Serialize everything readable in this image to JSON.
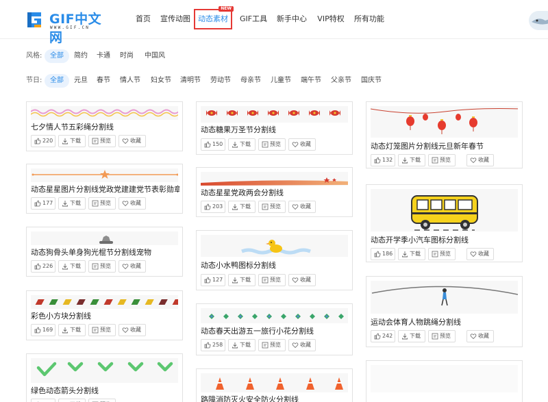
{
  "logo": {
    "text": "GIF中文网",
    "sub": "WWW.GIF.CN"
  },
  "nav": [
    {
      "label": "首页",
      "active": false
    },
    {
      "label": "宣传动图",
      "active": false
    },
    {
      "label": "动态素材",
      "active": true,
      "badge": "NEW"
    },
    {
      "label": "GIF工具",
      "active": false
    },
    {
      "label": "新手中心",
      "active": false
    },
    {
      "label": "VIP特权",
      "active": false
    },
    {
      "label": "所有功能",
      "active": false
    }
  ],
  "filters": {
    "style": {
      "label": "风格:",
      "options": [
        "全部",
        "简约",
        "卡通",
        "时尚",
        "中国风"
      ],
      "selected": 0
    },
    "festival": {
      "label": "节日:",
      "options": [
        "全部",
        "元旦",
        "春节",
        "情人节",
        "妇女节",
        "清明节",
        "劳动节",
        "母亲节",
        "儿童节",
        "端午节",
        "父亲节",
        "国庆节"
      ],
      "selected": 0
    }
  },
  "actions": {
    "download": "下载",
    "preview": "预览",
    "collect": "收藏"
  },
  "cards": [
    {
      "title": "七夕情人节五彩绳分割线",
      "likes": "220",
      "art": "wave"
    },
    {
      "title": "动态星星图片分割线党政党建建党节表彰勋章",
      "likes": "177",
      "art": "starline"
    },
    {
      "title": "动态狗骨头单身狗光棍节分割线宠物",
      "likes": "226",
      "art": "dog"
    },
    {
      "title": "彩色小方块分割线",
      "likes": "169",
      "art": "blocks"
    },
    {
      "title": "绿色动态箭头分割线",
      "likes": "",
      "art": "arrows"
    },
    {
      "title": "动态糖果万圣节分割线",
      "likes": "150",
      "art": "candy"
    },
    {
      "title": "动态星星党政两会分割线",
      "likes": "203",
      "art": "redband"
    },
    {
      "title": "动态小水鸭图标分割线",
      "likes": "127",
      "art": "duck"
    },
    {
      "title": "动态春天出游五一旅行小花分割线",
      "likes": "258",
      "art": "flowers"
    },
    {
      "title": "路障消防灭火安全防火分割线",
      "likes": "",
      "art": "cones"
    },
    {
      "title": "动态灯笼图片分割线元旦新年春节",
      "likes": "132",
      "art": "lanterns"
    },
    {
      "title": "动态开学季小汽车图标分割线",
      "likes": "186",
      "art": "bus"
    },
    {
      "title": "运动会体育人物跳绳分割线",
      "likes": "242",
      "art": "jump"
    },
    {
      "title": "",
      "likes": "",
      "art": "blank"
    }
  ]
}
